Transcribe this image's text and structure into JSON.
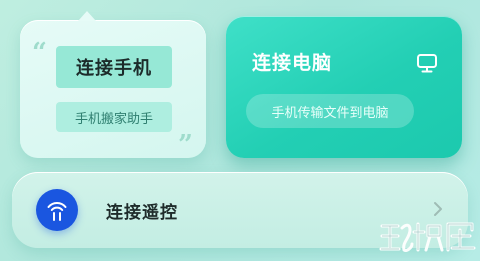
{
  "phone_card": {
    "title": "连接手机",
    "subtitle": "手机搬家助手"
  },
  "pc_card": {
    "title": "连接电脑",
    "subtitle": "手机传输文件到电脑",
    "icon": "monitor-icon"
  },
  "remote_card": {
    "title": "连接遥控",
    "icon": "remote-signal-icon",
    "chevron": "chevron-right-icon"
  },
  "watermark": {
    "text": "玩机屋"
  },
  "colors": {
    "accent_teal": "#23cfb4",
    "remote_blue": "#1a56e0",
    "background": "#b6ece6"
  }
}
